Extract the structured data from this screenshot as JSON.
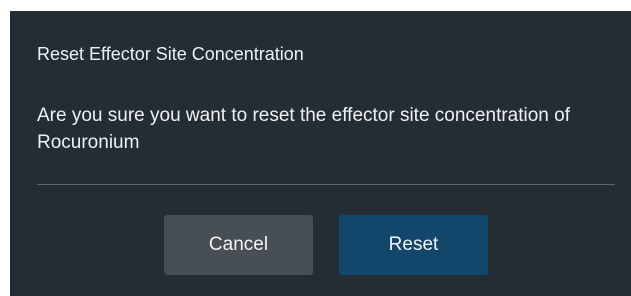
{
  "dialog": {
    "title": "Reset Effector Site Concentration",
    "message": "Are you sure you want to reset the effector site concentration of Rocuronium",
    "cancel_label": "Cancel",
    "reset_label": "Reset"
  },
  "colors": {
    "dialog_background": "#252d34",
    "cancel_button": "#474e54",
    "reset_button": "#12476b",
    "text": "#eef1f3"
  }
}
